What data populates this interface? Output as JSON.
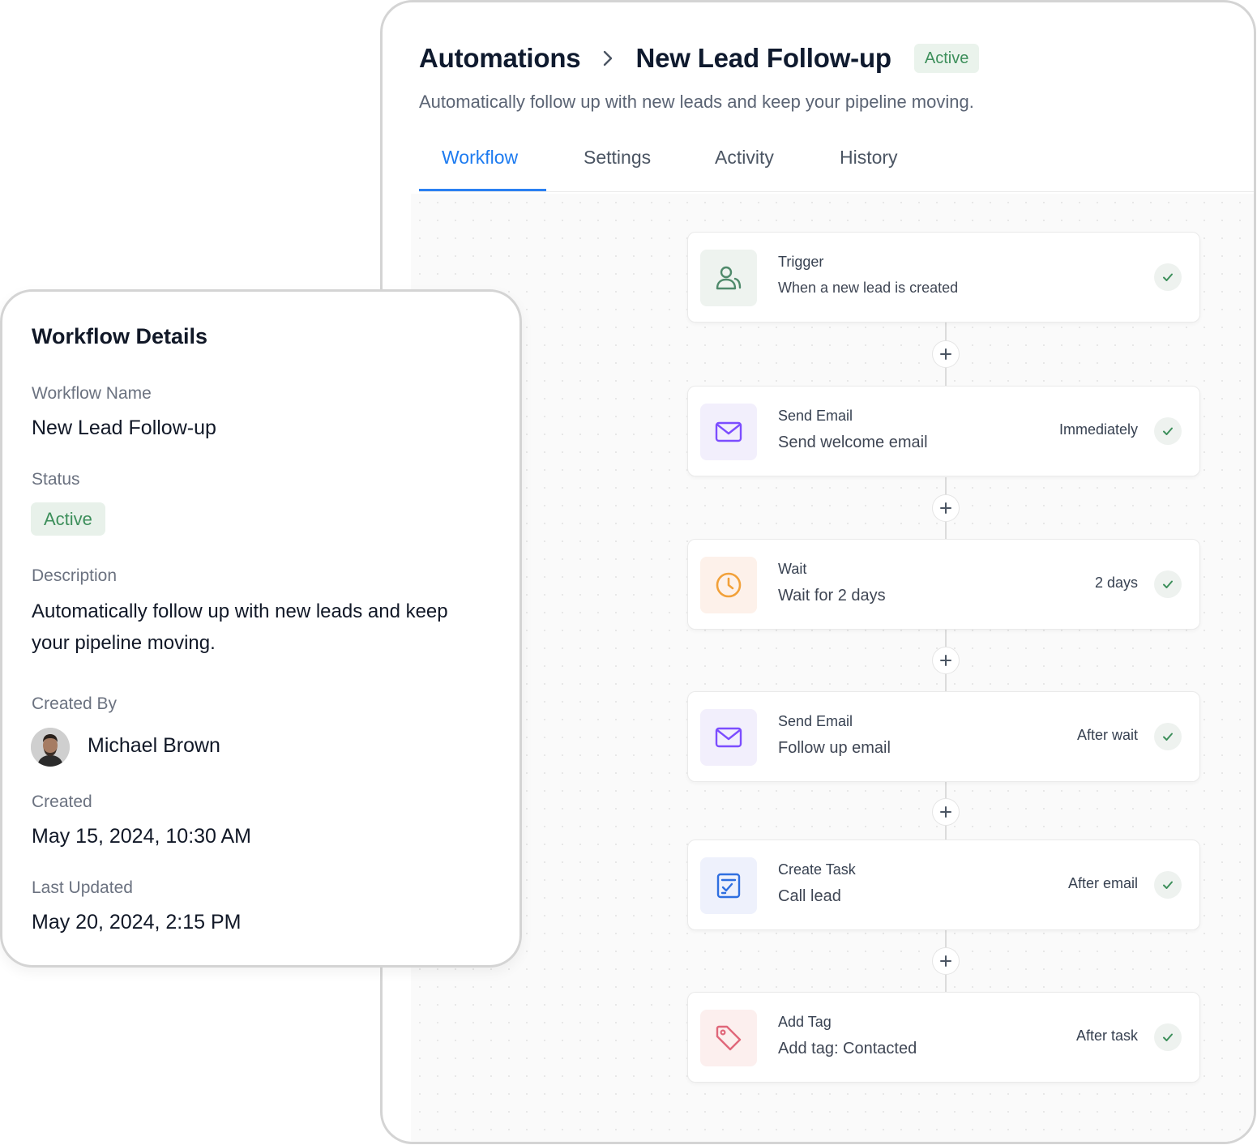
{
  "header": {
    "breadcrumb_root": "Automations",
    "breadcrumb_current": "New Lead Follow-up",
    "status": "Active",
    "subtitle": "Automatically follow up with new leads and keep your pipeline moving."
  },
  "tabs": [
    {
      "label": "Workflow",
      "active": true
    },
    {
      "label": "Settings",
      "active": false
    },
    {
      "label": "Activity",
      "active": false
    },
    {
      "label": "History",
      "active": false
    }
  ],
  "steps": [
    {
      "type": "Trigger",
      "description": "When a new lead is created",
      "timing": "",
      "icon": "user-icon",
      "completed": true
    },
    {
      "type": "Send Email",
      "description": "Send welcome email",
      "timing": "Immediately",
      "icon": "mail-icon",
      "completed": true
    },
    {
      "type": "Wait",
      "description": "Wait for 2 days",
      "timing": "2 days",
      "icon": "clock-icon",
      "completed": true
    },
    {
      "type": "Send Email",
      "description": "Follow up email",
      "timing": "After wait",
      "icon": "mail-icon",
      "completed": true
    },
    {
      "type": "Create Task",
      "description": "Call lead",
      "timing": "After email",
      "icon": "task-icon",
      "completed": true
    },
    {
      "type": "Add Tag",
      "description": "Add tag: Contacted",
      "timing": "After task",
      "icon": "tag-icon",
      "completed": true
    }
  ],
  "add_step_symbol": "+",
  "details": {
    "title": "Workflow Details",
    "workflow_name_label": "Workflow Name",
    "workflow_name": "New Lead Follow-up",
    "status_label": "Status",
    "status": "Active",
    "description_label": "Description",
    "description": "Automatically follow up with new leads and keep your pipeline moving.",
    "created_by_label": "Created By",
    "created_by": "Michael Brown",
    "created_label": "Created",
    "created": "May 15, 2024, 10:30 AM",
    "last_updated_label": "Last Updated",
    "last_updated": "May 20, 2024, 2:15 PM"
  },
  "colors": {
    "accent": "#1d7bf0",
    "active_green": "#3d8f5b",
    "trigger": "#4f8a6b",
    "email": "#7c4dff",
    "wait": "#f2a13a",
    "task": "#2f6fe0",
    "tag": "#e0677a"
  }
}
